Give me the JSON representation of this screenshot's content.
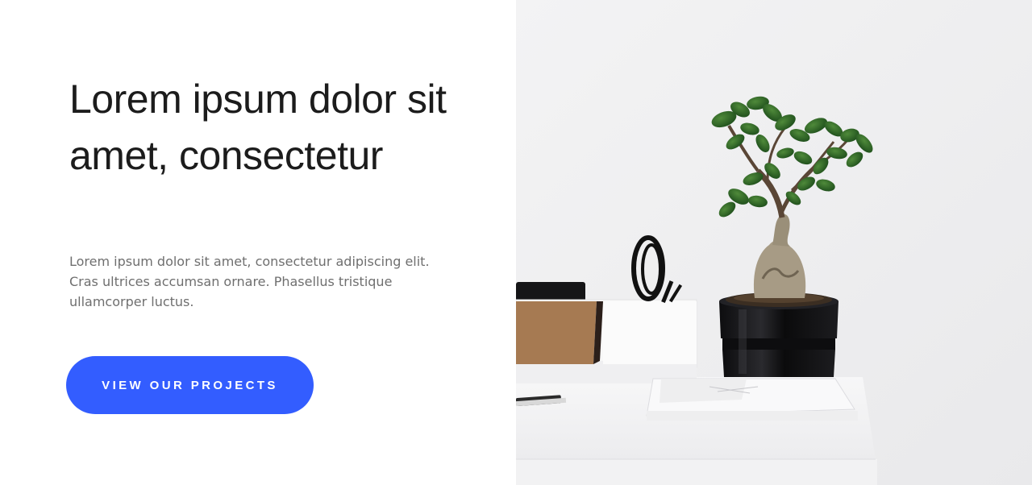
{
  "hero": {
    "title": "Lorem ipsum dolor sit amet, consectetur",
    "body": "Lorem ipsum dolor sit amet, consectetur adipiscing elit. Cras ultrices accumsan ornare. Phasellus tristique ullamcorper luctus.",
    "cta_label": "VIEW OUR PROJECTS"
  },
  "colors": {
    "accent": "#335dff",
    "title_text": "#1c1c1c",
    "body_text": "#6f6f6f"
  },
  "image": {
    "subject": "bonsai-plant-on-desk-photo"
  }
}
